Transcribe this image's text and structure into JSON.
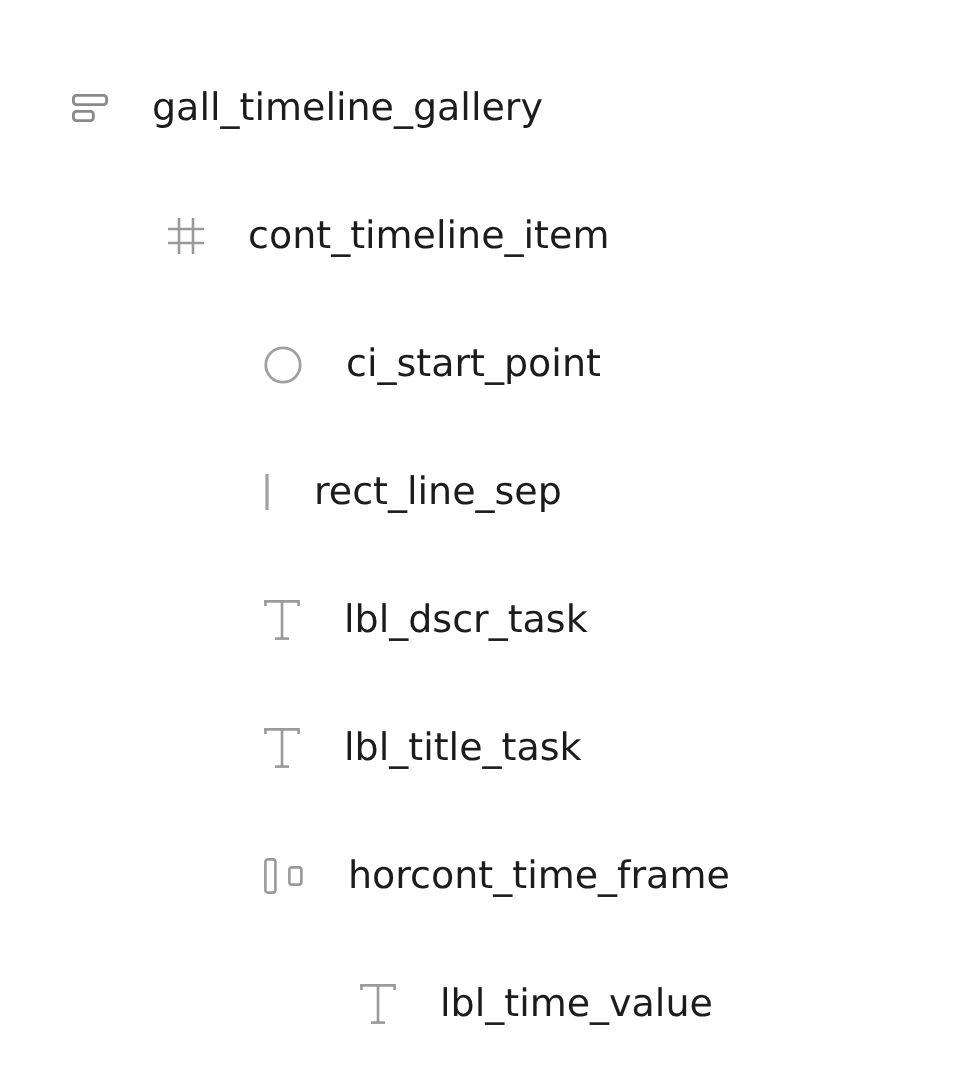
{
  "layers": [
    {
      "name": "gall_timeline_gallery",
      "kind": "gallery",
      "children": [
        {
          "name": "cont_timeline_item",
          "kind": "frame",
          "children": [
            {
              "name": "ci_start_point",
              "kind": "ellipse"
            },
            {
              "name": "rect_line_sep",
              "kind": "line"
            },
            {
              "name": "lbl_dscr_task",
              "kind": "text"
            },
            {
              "name": "lbl_title_task",
              "kind": "text"
            },
            {
              "name": "horcont_time_frame",
              "kind": "hstack",
              "children": [
                {
                  "name": "lbl_time_value",
                  "kind": "text"
                }
              ]
            }
          ]
        }
      ]
    }
  ]
}
